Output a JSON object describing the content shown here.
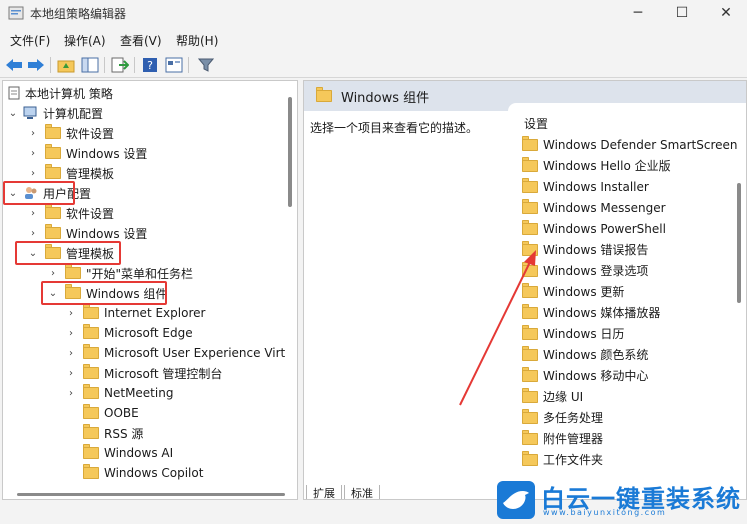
{
  "window": {
    "title": "本地组策略编辑器",
    "min_glyph": "─",
    "max_glyph": "☐",
    "close_glyph": "✕"
  },
  "menu": [
    "文件(F)",
    "操作(A)",
    "查看(V)",
    "帮助(H)"
  ],
  "tree": {
    "root": "本地计算机 策略",
    "computer_config": "计算机配置",
    "computer_children": [
      "软件设置",
      "Windows 设置",
      "管理模板"
    ],
    "user_config": "用户配置",
    "user_children": [
      "软件设置",
      "Windows 设置"
    ],
    "admin_templates": "管理模板",
    "start_menu": "\"开始\"菜单和任务栏",
    "windows_components": "Windows 组件",
    "component_children": [
      "Internet Explorer",
      "Microsoft Edge",
      "Microsoft User Experience Virt",
      "Microsoft 管理控制台",
      "NetMeeting",
      "OOBE",
      "RSS 源",
      "Windows AI",
      "Windows Copilot"
    ]
  },
  "right": {
    "header": "Windows 组件",
    "description": "选择一个项目来查看它的描述。",
    "column_header": "设置",
    "items": [
      "Windows Defender SmartScreen",
      "Windows Hello 企业版",
      "Windows Installer",
      "Windows Messenger",
      "Windows PowerShell",
      "Windows 错误报告",
      "Windows 登录选项",
      "Windows 更新",
      "Windows 媒体播放器",
      "Windows 日历",
      "Windows 颜色系统",
      "Windows 移动中心",
      "边缘 UI",
      "多任务处理",
      "附件管理器",
      "工作文件夹"
    ],
    "tabs": [
      "扩展",
      "标准"
    ]
  },
  "watermark": {
    "title": "白云一键重装系统",
    "url": "www.baiyunxitong.com"
  },
  "colors": {
    "highlight": "#e53935",
    "folder": "#f5c85a",
    "brand": "#1a7ad6"
  }
}
